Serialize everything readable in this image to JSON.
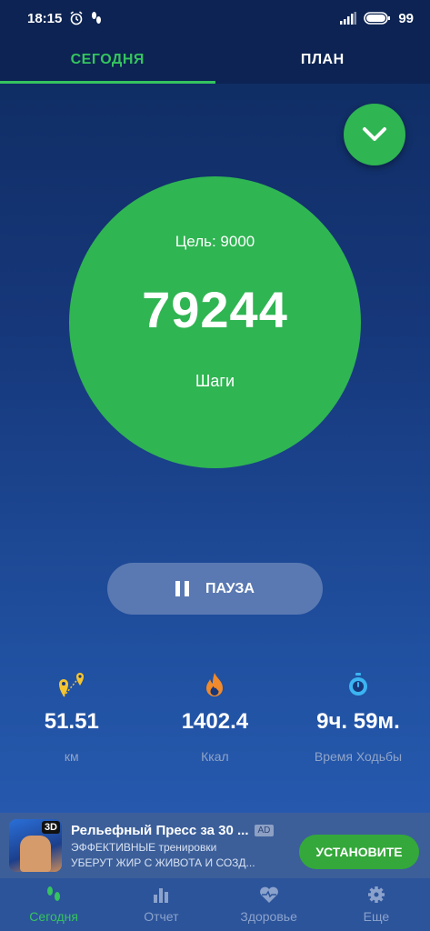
{
  "status_bar": {
    "time": "18:15",
    "battery": "99"
  },
  "tabs": [
    {
      "label": "СЕГОДНЯ"
    },
    {
      "label": "ПЛАН"
    }
  ],
  "goal": {
    "label": "Цель: 9000"
  },
  "steps": {
    "value": "79244",
    "label": "Шаги"
  },
  "pause_button": {
    "label": "ПАУЗА"
  },
  "stats": [
    {
      "icon": "location-pins-icon",
      "value": "51.51",
      "label": "км",
      "color": "#f4c430"
    },
    {
      "icon": "flame-icon",
      "value": "1402.4",
      "label": "Ккал",
      "color": "#f08a2c"
    },
    {
      "icon": "stopwatch-icon",
      "value": "9ч. 59м.",
      "label": "Время Ходьбы",
      "color": "#3bb4f2"
    }
  ],
  "ad": {
    "badge_3d": "3D",
    "title": "Рельефный Пресс за 30 ...",
    "tag": "AD",
    "line1": "ЭФФЕКТИВНЫЕ тренировки",
    "line2": "УБЕРУТ ЖИР С ЖИВОТА И СОЗД...",
    "cta": "УСТАНОВИТЕ"
  },
  "bottom_nav": [
    {
      "icon": "footsteps-icon",
      "label": "Сегодня"
    },
    {
      "icon": "bar-chart-icon",
      "label": "Отчет"
    },
    {
      "icon": "heart-pulse-icon",
      "label": "Здоровье"
    },
    {
      "icon": "gear-icon",
      "label": "Еще"
    }
  ],
  "colors": {
    "accent": "#35c45e",
    "circle": "#2fb552",
    "background": "#16377a"
  }
}
